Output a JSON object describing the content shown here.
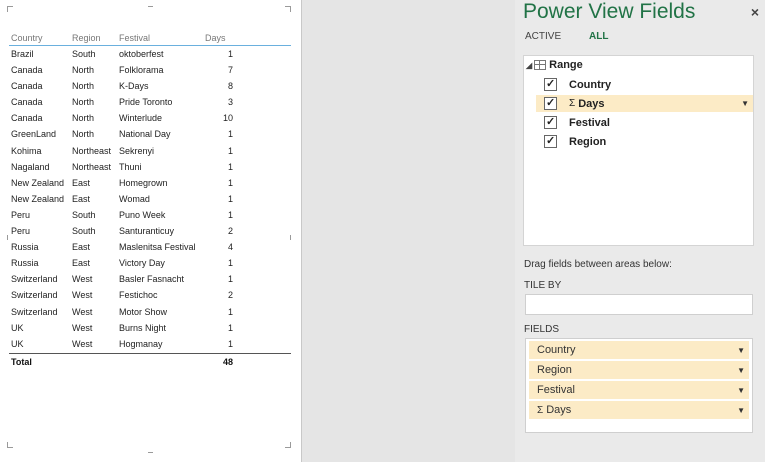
{
  "table": {
    "columns": [
      "Country",
      "Region",
      "Festival",
      "Days"
    ],
    "rows": [
      [
        "Brazil",
        "South",
        "oktoberfest",
        "1"
      ],
      [
        "Canada",
        "North",
        "Folklorama",
        "7"
      ],
      [
        "Canada",
        "North",
        "K-Days",
        "8"
      ],
      [
        "Canada",
        "North",
        "Pride Toronto",
        "3"
      ],
      [
        "Canada",
        "North",
        "Winterlude",
        "10"
      ],
      [
        "GreenLand",
        "North",
        "National Day",
        "1"
      ],
      [
        "Kohima",
        "Northeast",
        "Sekrenyi",
        "1"
      ],
      [
        "Nagaland",
        "Northeast",
        "Thuni",
        "1"
      ],
      [
        "New Zealand",
        "East",
        "Homegrown",
        "1"
      ],
      [
        "New Zealand",
        "East",
        "Womad",
        "1"
      ],
      [
        "Peru",
        "South",
        "Puno Week",
        "1"
      ],
      [
        "Peru",
        "South",
        "Santuranticuy",
        "2"
      ],
      [
        "Russia",
        "East",
        "Maslenitsa Festival",
        "4"
      ],
      [
        "Russia",
        "East",
        "Victory Day",
        "1"
      ],
      [
        "Switzerland",
        "West",
        "Basler Fasnacht",
        "1"
      ],
      [
        "Switzerland",
        "West",
        "Festichoc",
        "2"
      ],
      [
        "Switzerland",
        "West",
        "Motor Show",
        "1"
      ],
      [
        "UK",
        "West",
        "Burns Night",
        "1"
      ],
      [
        "UK",
        "West",
        "Hogmanay",
        "1"
      ]
    ],
    "total_label": "Total",
    "total_value": "48"
  },
  "pane": {
    "title": "Power View Fields",
    "close": "×",
    "tab_active": "ACTIVE",
    "tab_all": "ALL",
    "table_name": "Range",
    "fields": [
      {
        "label": "Country",
        "sigma": false,
        "highlight": false
      },
      {
        "label": "Days",
        "sigma": true,
        "highlight": true
      },
      {
        "label": "Festival",
        "sigma": false,
        "highlight": false
      },
      {
        "label": "Region",
        "sigma": false,
        "highlight": false
      }
    ],
    "drag_hint": "Drag fields between areas below:",
    "tile_by_label": "TILE BY",
    "fields_label": "FIELDS",
    "well_items": [
      {
        "label": "Country",
        "sigma": false
      },
      {
        "label": "Region",
        "sigma": false
      },
      {
        "label": "Festival",
        "sigma": false
      },
      {
        "label": "Days",
        "sigma": true
      }
    ],
    "accent_color": "#217346",
    "highlight_color": "#fcebc6"
  }
}
